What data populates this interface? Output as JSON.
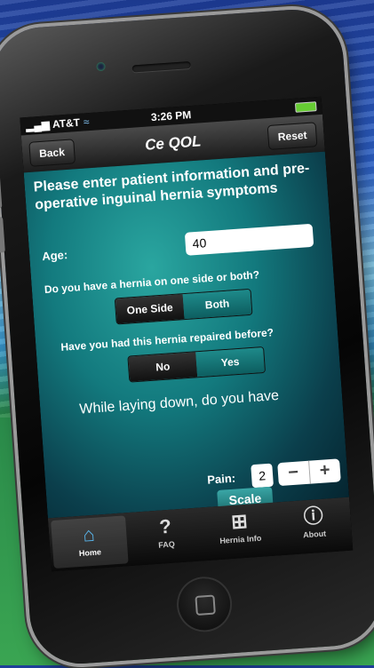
{
  "status": {
    "carrier": "AT&T",
    "time": "3:26 PM"
  },
  "nav": {
    "back": "Back",
    "title": "Ce QOL",
    "reset": "Reset"
  },
  "form": {
    "heading": "Please enter patient information and pre-operative inguinal hernia symptoms",
    "age_label": "Age:",
    "age_value": "40",
    "side_question": "Do you have a hernia on one side or both?",
    "side_options": [
      "One Side",
      "Both"
    ],
    "repaired_question": "Have you had this hernia repaired before?",
    "repaired_options": [
      "No",
      "Yes"
    ],
    "laying_text": "While laying down, do you have",
    "pain_label": "Pain:",
    "pain_value": "2",
    "minus": "−",
    "plus": "+",
    "scale_label": "Scale"
  },
  "tabs": [
    {
      "label": "Home",
      "icon": "home-icon"
    },
    {
      "label": "FAQ",
      "icon": "question-icon"
    },
    {
      "label": "Hernia Info",
      "icon": "medical-kit-icon"
    },
    {
      "label": "About",
      "icon": "info-icon"
    }
  ],
  "colors": {
    "accent": "#1e8a8a",
    "tab_active": "#5ab8f0"
  }
}
